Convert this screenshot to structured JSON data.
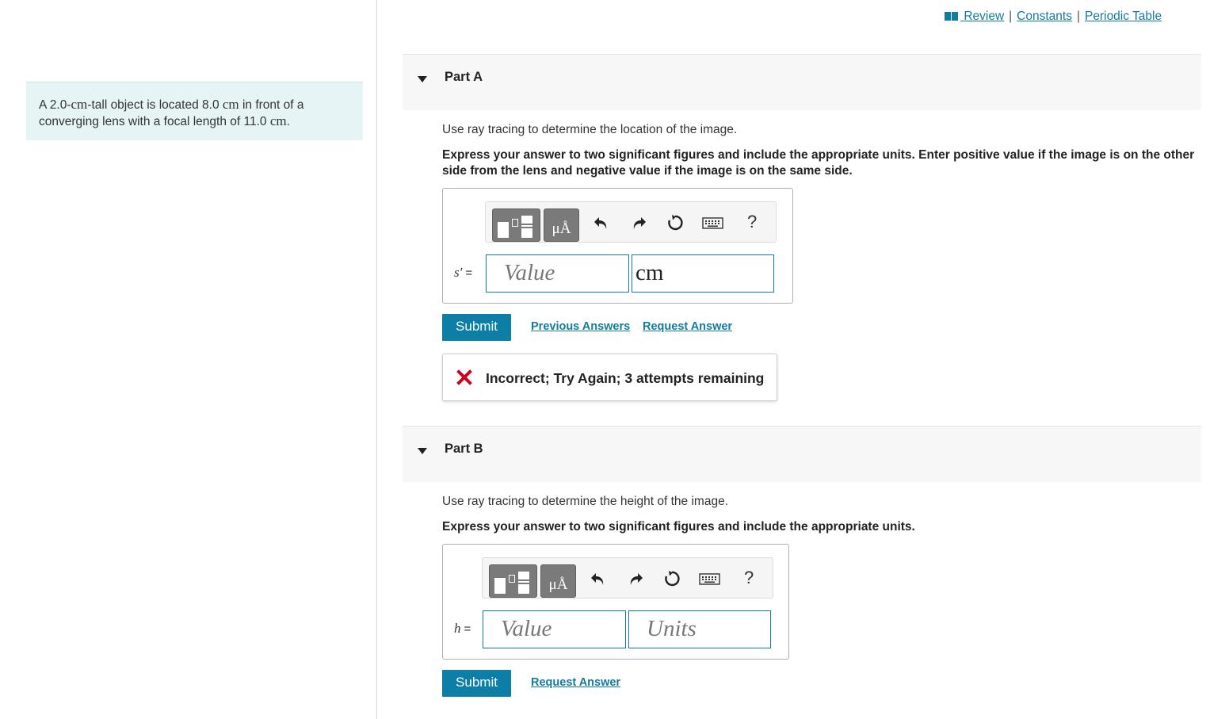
{
  "problem": {
    "p1": "A 2.0-",
    "u1": "cm",
    "p2": "-tall object is located 8.0 ",
    "u2": "cm",
    "p3": " in front of a converging lens with a focal length of 11.0 ",
    "u3": "cm",
    "p4": "."
  },
  "top_links": {
    "review": "Review",
    "constants": "Constants",
    "periodic_table": "Periodic Table",
    "separator": "|"
  },
  "part_a": {
    "title": "Part A",
    "prompt": "Use ray tracing to determine the location of the image.",
    "instruction": "Express your answer to two significant figures and include the appropriate units. Enter positive value if the image is on the other side from the lens and negative value if the image is on the same side.",
    "variable": "s′",
    "equals": "=",
    "value_placeholder": "Value",
    "units_value": "cm",
    "submit_label": "Submit",
    "previous_answers_label": "Previous Answers",
    "request_answer_label": "Request Answer",
    "feedback": "Incorrect; Try Again; 3 attempts remaining"
  },
  "part_b": {
    "title": "Part B",
    "prompt": "Use ray tracing to determine the height of the image.",
    "instruction": "Express your answer to two significant figures and include the appropriate units.",
    "variable": "h",
    "equals": "=",
    "value_placeholder": "Value",
    "units_placeholder": "Units",
    "submit_label": "Submit",
    "request_answer_label": "Request Answer"
  },
  "toolbar": {
    "units_glyph": "μÅ",
    "help": "?",
    "icons": [
      "templates-icon",
      "units-icon",
      "undo-icon",
      "redo-icon",
      "reset-icon",
      "keyboard-icon",
      "help-icon"
    ]
  },
  "colors": {
    "accent": "#137c9c",
    "submit_bg": "#0d7ea6",
    "intro_bg": "#e6f4f5",
    "error": "#d0021b"
  }
}
